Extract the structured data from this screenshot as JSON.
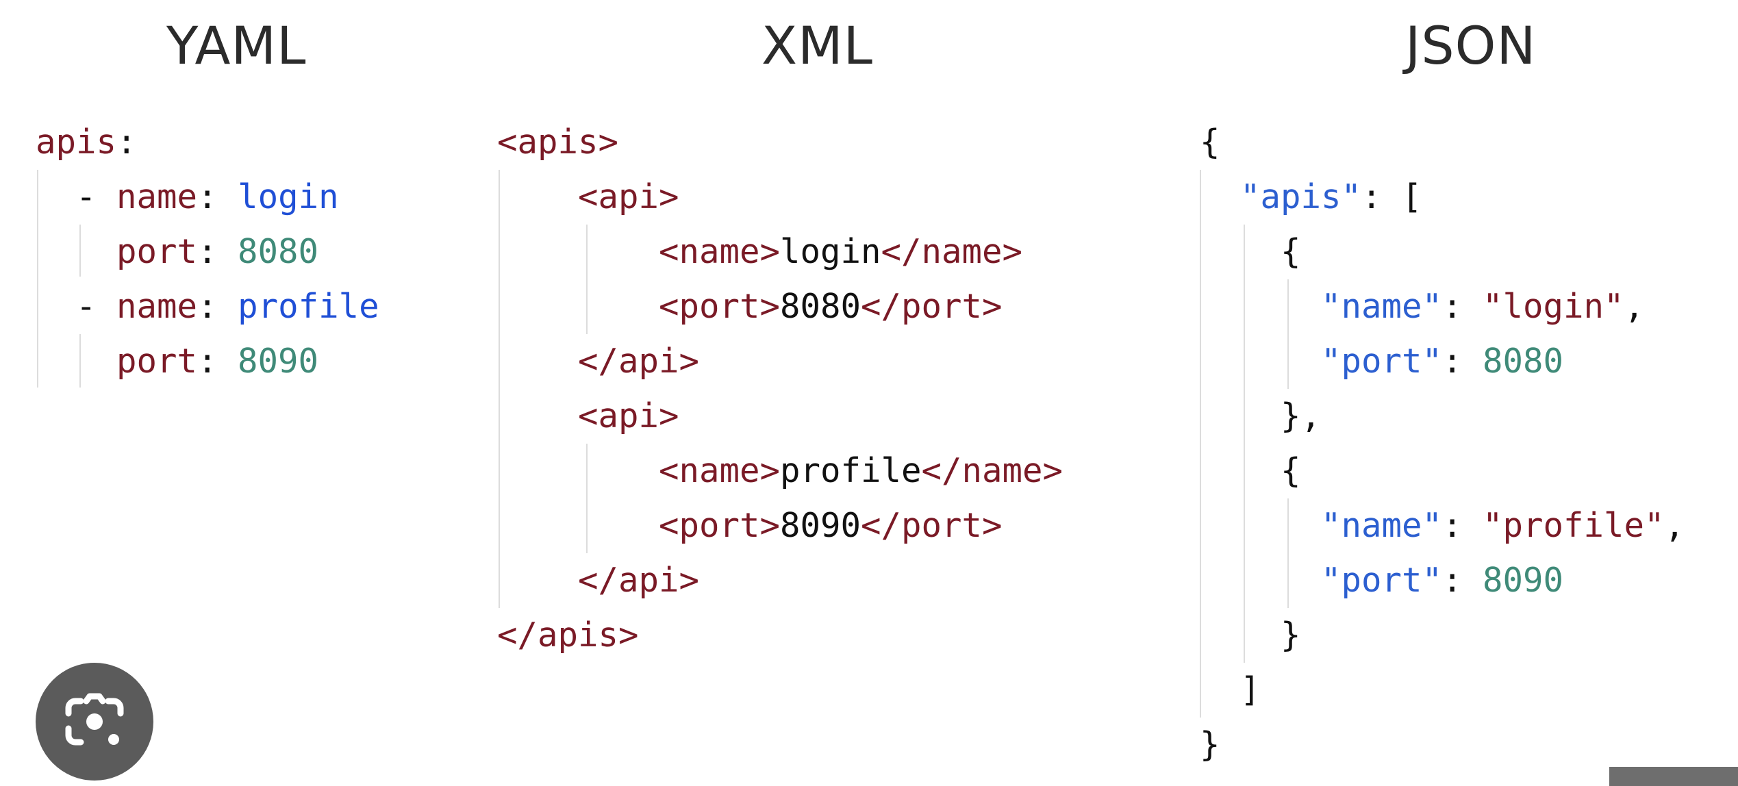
{
  "headings": {
    "yaml": "YAML",
    "xml": "XML",
    "json": "JSON"
  },
  "yaml": [
    {
      "indent": "",
      "parts": [
        {
          "t": "apis",
          "c": "key"
        },
        {
          "t": ":",
          "c": "pun"
        }
      ]
    },
    {
      "indent": "  ",
      "parts": [
        {
          "t": "- ",
          "c": "bullet"
        },
        {
          "t": "name",
          "c": "key"
        },
        {
          "t": ": ",
          "c": "pun"
        },
        {
          "t": "login",
          "c": "name"
        }
      ]
    },
    {
      "indent": "    ",
      "parts": [
        {
          "t": "port",
          "c": "key"
        },
        {
          "t": ": ",
          "c": "pun"
        },
        {
          "t": "8080",
          "c": "num"
        }
      ]
    },
    {
      "indent": "  ",
      "parts": [
        {
          "t": "- ",
          "c": "bullet"
        },
        {
          "t": "name",
          "c": "key"
        },
        {
          "t": ": ",
          "c": "pun"
        },
        {
          "t": "profile",
          "c": "name"
        }
      ]
    },
    {
      "indent": "    ",
      "parts": [
        {
          "t": "port",
          "c": "key"
        },
        {
          "t": ": ",
          "c": "pun"
        },
        {
          "t": "8090",
          "c": "num"
        }
      ]
    }
  ],
  "xml": [
    {
      "indent": "",
      "parts": [
        {
          "t": "<apis>",
          "c": "tag"
        }
      ]
    },
    {
      "indent": "    ",
      "parts": [
        {
          "t": "<api>",
          "c": "tag"
        }
      ]
    },
    {
      "indent": "        ",
      "parts": [
        {
          "t": "<name>",
          "c": "tag"
        },
        {
          "t": "login",
          "c": "pun"
        },
        {
          "t": "</name>",
          "c": "tag"
        }
      ]
    },
    {
      "indent": "        ",
      "parts": [
        {
          "t": "<port>",
          "c": "tag"
        },
        {
          "t": "8080",
          "c": "pun"
        },
        {
          "t": "</port>",
          "c": "tag"
        }
      ]
    },
    {
      "indent": "    ",
      "parts": [
        {
          "t": "</api>",
          "c": "tag"
        }
      ]
    },
    {
      "indent": "    ",
      "parts": [
        {
          "t": "<api>",
          "c": "tag"
        }
      ]
    },
    {
      "indent": "        ",
      "parts": [
        {
          "t": "<name>",
          "c": "tag"
        },
        {
          "t": "profile",
          "c": "pun"
        },
        {
          "t": "</name>",
          "c": "tag"
        }
      ]
    },
    {
      "indent": "        ",
      "parts": [
        {
          "t": "<port>",
          "c": "tag"
        },
        {
          "t": "8090",
          "c": "pun"
        },
        {
          "t": "</port>",
          "c": "tag"
        }
      ]
    },
    {
      "indent": "    ",
      "parts": [
        {
          "t": "</api>",
          "c": "tag"
        }
      ]
    },
    {
      "indent": "",
      "parts": [
        {
          "t": "</apis>",
          "c": "tag"
        }
      ]
    }
  ],
  "json": [
    {
      "indent": "",
      "parts": [
        {
          "t": "{",
          "c": "pun"
        }
      ]
    },
    {
      "indent": "  ",
      "parts": [
        {
          "t": "\"apis\"",
          "c": "q"
        },
        {
          "t": ": [",
          "c": "pun"
        }
      ]
    },
    {
      "indent": "    ",
      "parts": [
        {
          "t": "{",
          "c": "pun"
        }
      ]
    },
    {
      "indent": "      ",
      "parts": [
        {
          "t": "\"name\"",
          "c": "q"
        },
        {
          "t": ": ",
          "c": "pun"
        },
        {
          "t": "\"login\"",
          "c": "str"
        },
        {
          "t": ",",
          "c": "pun"
        }
      ]
    },
    {
      "indent": "      ",
      "parts": [
        {
          "t": "\"port\"",
          "c": "q"
        },
        {
          "t": ": ",
          "c": "pun"
        },
        {
          "t": "8080",
          "c": "num"
        }
      ]
    },
    {
      "indent": "    ",
      "parts": [
        {
          "t": "},",
          "c": "pun"
        }
      ]
    },
    {
      "indent": "    ",
      "parts": [
        {
          "t": "{",
          "c": "pun"
        }
      ]
    },
    {
      "indent": "      ",
      "parts": [
        {
          "t": "\"name\"",
          "c": "q"
        },
        {
          "t": ": ",
          "c": "pun"
        },
        {
          "t": "\"profile\"",
          "c": "str"
        },
        {
          "t": ",",
          "c": "pun"
        }
      ]
    },
    {
      "indent": "      ",
      "parts": [
        {
          "t": "\"port\"",
          "c": "q"
        },
        {
          "t": ": ",
          "c": "pun"
        },
        {
          "t": "8090",
          "c": "num"
        }
      ]
    },
    {
      "indent": "    ",
      "parts": [
        {
          "t": "}",
          "c": "pun"
        }
      ]
    },
    {
      "indent": "  ",
      "parts": [
        {
          "t": "]",
          "c": "pun"
        }
      ]
    },
    {
      "indent": "",
      "parts": [
        {
          "t": "}",
          "c": "pun"
        }
      ]
    }
  ],
  "lens_button": {
    "icon": "camera-lens-icon"
  },
  "colors": {
    "tag": "#7a1a26",
    "value_name": "#1f4fd6",
    "number": "#3f8a78",
    "json_key": "#2c5fd0",
    "heading": "#2b2b2b"
  }
}
